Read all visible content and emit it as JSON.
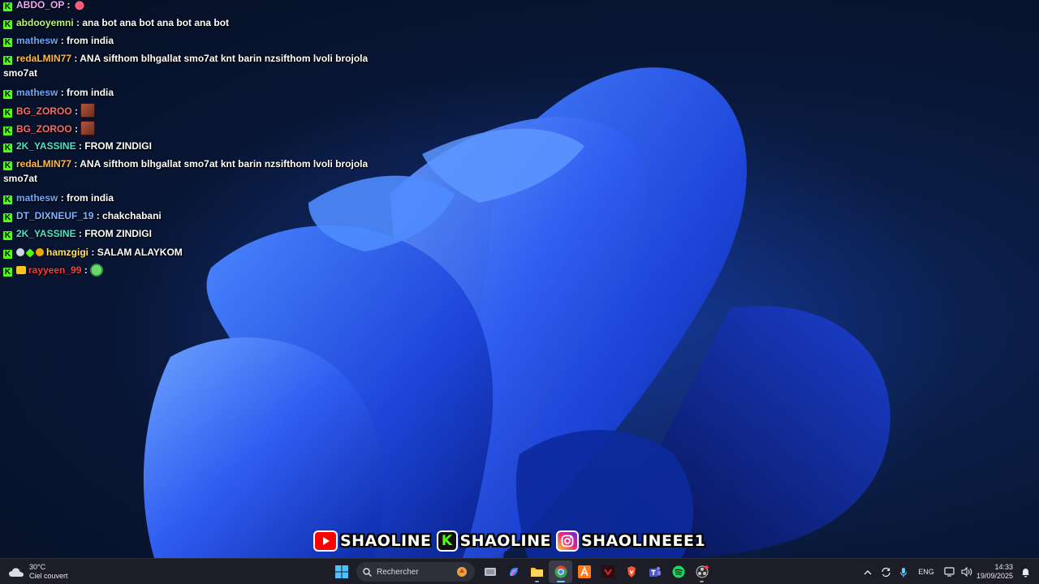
{
  "chat": {
    "messages": [
      {
        "user": "ABDO_OP",
        "sep": ":",
        "text": "",
        "user_color": "#f0a6ff",
        "emote": "crab-emote",
        "badges": [
          "kick"
        ]
      },
      {
        "user": "abdooyemni",
        "sep": ":",
        "text": "ana bot ana bot ana bot ana bot",
        "user_color": "#b7f57b",
        "badges": [
          "kick"
        ]
      },
      {
        "user": "mathesw",
        "sep": ":",
        "text": "from india",
        "user_color": "#6fa8ff",
        "badges": [
          "kick"
        ]
      },
      {
        "user": "redaLMIN77",
        "sep": ":",
        "text": "ANA sifthom blhgallat smo7at knt barin nzsifthom lvoli brojola",
        "text2": "smo7at",
        "user_color": "#ffb64a",
        "badges": [
          "kick"
        ]
      },
      {
        "user": "mathesw",
        "sep": ":",
        "text": "from india",
        "user_color": "#6fa8ff",
        "badges": [
          "kick"
        ]
      },
      {
        "user": "BG_ZOROO",
        "sep": ":",
        "text": "",
        "user_color": "#ff6b6b",
        "emote": "face-emote",
        "badges": [
          "kick"
        ]
      },
      {
        "user": "BG_ZOROO",
        "sep": ":",
        "text": "",
        "user_color": "#ff6b6b",
        "emote": "face-emote",
        "badges": [
          "kick"
        ]
      },
      {
        "user": "2K_YASSINE",
        "sep": ":",
        "text": "FROM ZINDIGI",
        "user_color": "#4de3c8",
        "badges": [
          "kick"
        ]
      },
      {
        "user": "redaLMIN77",
        "sep": ":",
        "text": "ANA sifthom blhgallat smo7at knt barin nzsifthom lvoli brojola",
        "text2": "smo7at",
        "user_color": "#ffb64a",
        "badges": [
          "kick"
        ]
      },
      {
        "user": "mathesw",
        "sep": ":",
        "text": "from india",
        "user_color": "#6fa8ff",
        "badges": [
          "kick"
        ]
      },
      {
        "user": "DT_DIXNEUF_19",
        "sep": ":",
        "text": "chakchabani",
        "user_color": "#7fb3ff",
        "badges": [
          "kick"
        ]
      },
      {
        "user": "2K_YASSINE",
        "sep": ":",
        "text": "FROM ZINDIGI",
        "user_color": "#4de3c8",
        "badges": [
          "kick"
        ]
      },
      {
        "user": "hamzgigi",
        "sep": ":",
        "text": "SALAM ALAYKOM",
        "user_color": "#ffe36b",
        "badges": [
          "kick",
          "verified",
          "gift",
          "sub"
        ]
      },
      {
        "user": "rayyeen_99",
        "sep": ":",
        "text": "",
        "user_color": "#ff3b3b",
        "emote": "green-emote",
        "badges": [
          "kick",
          "crown"
        ]
      }
    ]
  },
  "banner": {
    "youtube": "SHAOLINE",
    "kick": "SHAOLINE",
    "instagram": "SHAOLINEEE1",
    "kick_letter": "K"
  },
  "taskbar": {
    "weather_temp": "30°C",
    "weather_desc": "Ciel couvert",
    "search_placeholder": "Rechercher",
    "lang": "ENG",
    "time": "14:33",
    "date": "19/09/2025",
    "pinned_icons": [
      "start-icon",
      "search-box",
      "task-view-icon",
      "copilot-icon",
      "file-explorer-icon",
      "chrome-icon",
      "app-a-icon",
      "app-tv-icon",
      "brave-icon",
      "teams-icon",
      "spotify-icon",
      "obs-icon"
    ]
  },
  "colors": {
    "kick_green": "#53fc18",
    "taskbar_bg": "#1c1d26",
    "youtube_red": "#ff0000"
  }
}
